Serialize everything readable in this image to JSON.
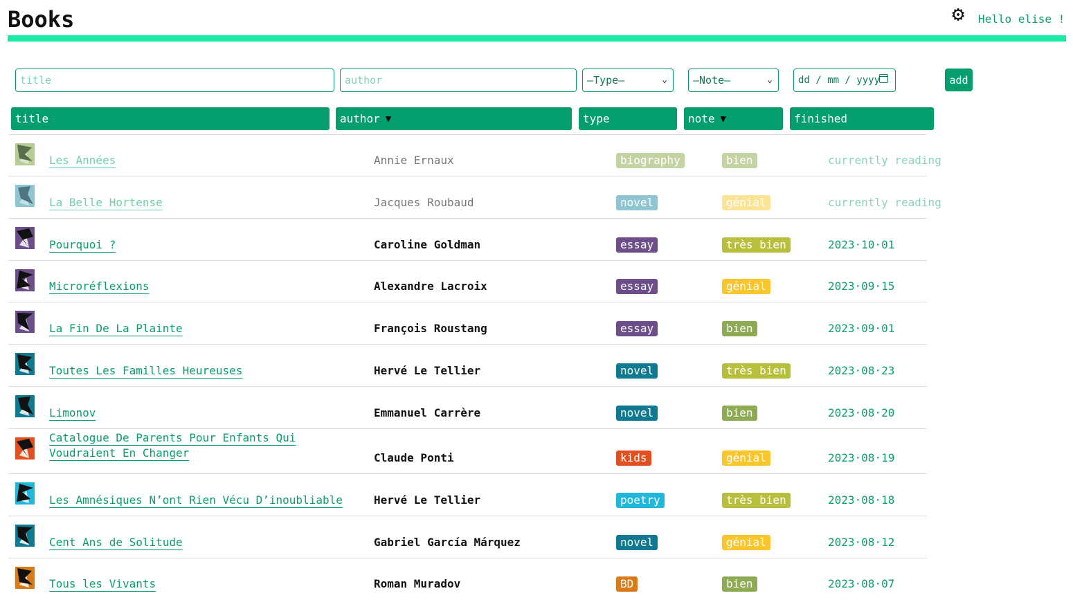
{
  "header": {
    "title": "Books",
    "greeting": "Hello elise !",
    "settings_icon": "gear-icon",
    "accent_color": "#1de9a6"
  },
  "form": {
    "title_placeholder": "title",
    "author_placeholder": "author",
    "type_select": "—Type—",
    "note_select": "—Note—",
    "date_placeholder": "dd / mm / yyyy",
    "add_label": "add"
  },
  "columns": {
    "title": "title",
    "author": "author",
    "author_sort": "▼",
    "type": "type",
    "note": "note",
    "note_sort": "▼",
    "finished": "finished"
  },
  "colors": {
    "primary": "#049d6e",
    "link": "#0b9d6b"
  },
  "books": [
    {
      "title": "Les Années",
      "author": "Annie Ernaux",
      "type": "biography",
      "type_color": "#c4d3a4",
      "note": "bien",
      "note_color": "#c4d3a4",
      "finished": "currently reading",
      "cover_bg": "#b5cc94",
      "cover_fg": "#5a6e4a"
    },
    {
      "title": "La Belle Hortense",
      "author": "Jacques Roubaud",
      "type": "novel",
      "type_color": "#8fc6d1",
      "note": "génial",
      "note_color": "#fde394",
      "finished": "currently reading",
      "cover_bg": "#8fc6d1",
      "cover_fg": "#4f7680"
    },
    {
      "title": "Pourquoi ?",
      "author": "Caroline Goldman",
      "type": "essay",
      "type_color": "#6b4e8a",
      "note": "très bien",
      "note_color": "#b8bf3c",
      "finished": "2023·10·01",
      "cover_bg": "#6b4e8a",
      "cover_fg": "#111111"
    },
    {
      "title": "Microréflexions",
      "author": "Alexandre Lacroix",
      "type": "essay",
      "type_color": "#6b4e8a",
      "note": "génial",
      "note_color": "#fbc52c",
      "finished": "2023·09·15",
      "cover_bg": "#6b4e8a",
      "cover_fg": "#111111"
    },
    {
      "title": "La Fin De La Plainte",
      "author": "François Roustang",
      "type": "essay",
      "type_color": "#6b4e8a",
      "note": "bien",
      "note_color": "#8faa55",
      "finished": "2023·09·01",
      "cover_bg": "#6b4e8a",
      "cover_fg": "#111111"
    },
    {
      "title": "Toutes Les Familles Heureuses",
      "author": "Hervé Le Tellier",
      "type": "novel",
      "type_color": "#0f7a8f",
      "note": "très bien",
      "note_color": "#b8bf3c",
      "finished": "2023·08·23",
      "cover_bg": "#0f7a8f",
      "cover_fg": "#111111"
    },
    {
      "title": "Limonov",
      "author": "Emmanuel Carrère",
      "type": "novel",
      "type_color": "#0f7a8f",
      "note": "bien",
      "note_color": "#8faa55",
      "finished": "2023·08·20",
      "cover_bg": "#0f7a8f",
      "cover_fg": "#111111"
    },
    {
      "title": "Catalogue De Parents Pour Enfants Qui Voudraient En Changer",
      "title_line1": "Catalogue De Parents Pour Enfants Qui",
      "title_line2": "Voudraient En Changer",
      "author": "Claude Ponti",
      "type": "kids",
      "type_color": "#e0501f",
      "note": "génial",
      "note_color": "#fbc52c",
      "finished": "2023·08·19",
      "cover_bg": "#e0501f",
      "cover_fg": "#111111"
    },
    {
      "title": "Les Amnésiques N’ont Rien Vécu D’inoubliable",
      "author": "Hervé Le Tellier",
      "type": "poetry",
      "type_color": "#1fb8dc",
      "note": "très bien",
      "note_color": "#b8bf3c",
      "finished": "2023·08·18",
      "cover_bg": "#1fb8dc",
      "cover_fg": "#111111"
    },
    {
      "title": "Cent Ans de Solitude",
      "author": "Gabriel García Márquez",
      "type": "novel",
      "type_color": "#0f7a8f",
      "note": "génial",
      "note_color": "#fbc52c",
      "finished": "2023·08·12",
      "cover_bg": "#0f7a8f",
      "cover_fg": "#111111"
    },
    {
      "title": "Tous les Vivants",
      "author": "Roman Muradov",
      "type": "BD",
      "type_color": "#d97a18",
      "note": "bien",
      "note_color": "#8faa55",
      "finished": "2023·08·07",
      "cover_bg": "#d97a18",
      "cover_fg": "#111111"
    }
  ]
}
